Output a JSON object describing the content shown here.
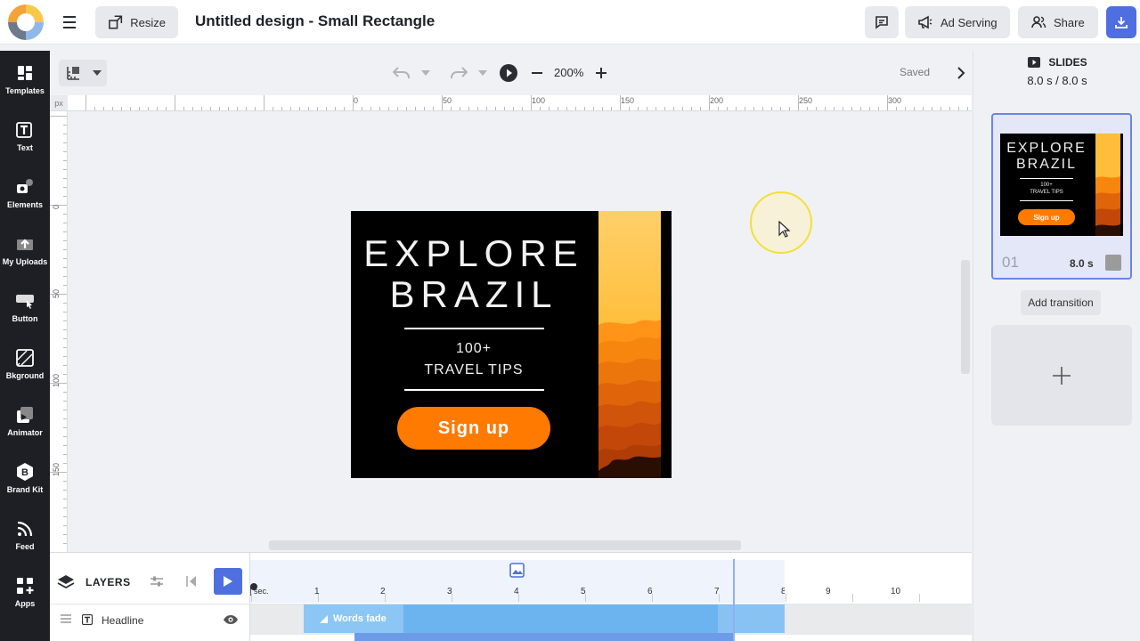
{
  "header": {
    "resize_label": "Resize",
    "title": "Untitled design - Small Rectangle",
    "ad_serving_label": "Ad Serving",
    "share_label": "Share"
  },
  "sidebar": {
    "items": [
      {
        "label": "Templates",
        "icon": "templates-icon"
      },
      {
        "label": "Text",
        "icon": "text-icon"
      },
      {
        "label": "Elements",
        "icon": "elements-icon"
      },
      {
        "label": "My Uploads",
        "icon": "upload-icon"
      },
      {
        "label": "Button",
        "icon": "button-icon"
      },
      {
        "label": "Bkground",
        "icon": "background-icon"
      },
      {
        "label": "Animator",
        "icon": "animator-icon"
      },
      {
        "label": "Brand Kit",
        "icon": "brand-kit-icon"
      },
      {
        "label": "Feed",
        "icon": "feed-icon"
      },
      {
        "label": "Apps",
        "icon": "apps-icon"
      }
    ]
  },
  "toolbar": {
    "zoom": "200%",
    "saved": "Saved"
  },
  "ruler": {
    "unit": "px",
    "h_labels": [
      "0",
      "50",
      "100",
      "150",
      "200",
      "250",
      "300"
    ],
    "v_labels": [
      "0",
      "50",
      "100",
      "150"
    ]
  },
  "design": {
    "headline_line1": "EXPLORE",
    "headline_line2": "BRAZIL",
    "sub_line1": "100+",
    "sub_line2": "TRAVEL TIPS",
    "cta": "Sign up",
    "colors": {
      "background": "#000000",
      "cta": "#ff7a00",
      "text": "#f2f2f2"
    }
  },
  "slides": {
    "title": "SLIDES",
    "time": "8.0 s / 8.0 s",
    "items": [
      {
        "number": "01",
        "duration": "8.0 s"
      }
    ],
    "add_transition": "Add transition"
  },
  "timeline": {
    "layers_label": "LAYERS",
    "scale_start": "sec.",
    "scale_numbers": [
      "1",
      "2",
      "3",
      "4",
      "5",
      "6",
      "7",
      "8",
      "9",
      "10"
    ],
    "rows": [
      {
        "name": "Headline",
        "effect": "Words fade"
      }
    ]
  },
  "colors": {
    "accent": "#4f6fe0",
    "sidebar_bg": "#1d1f24",
    "track_bar": "#6cb4f0"
  }
}
